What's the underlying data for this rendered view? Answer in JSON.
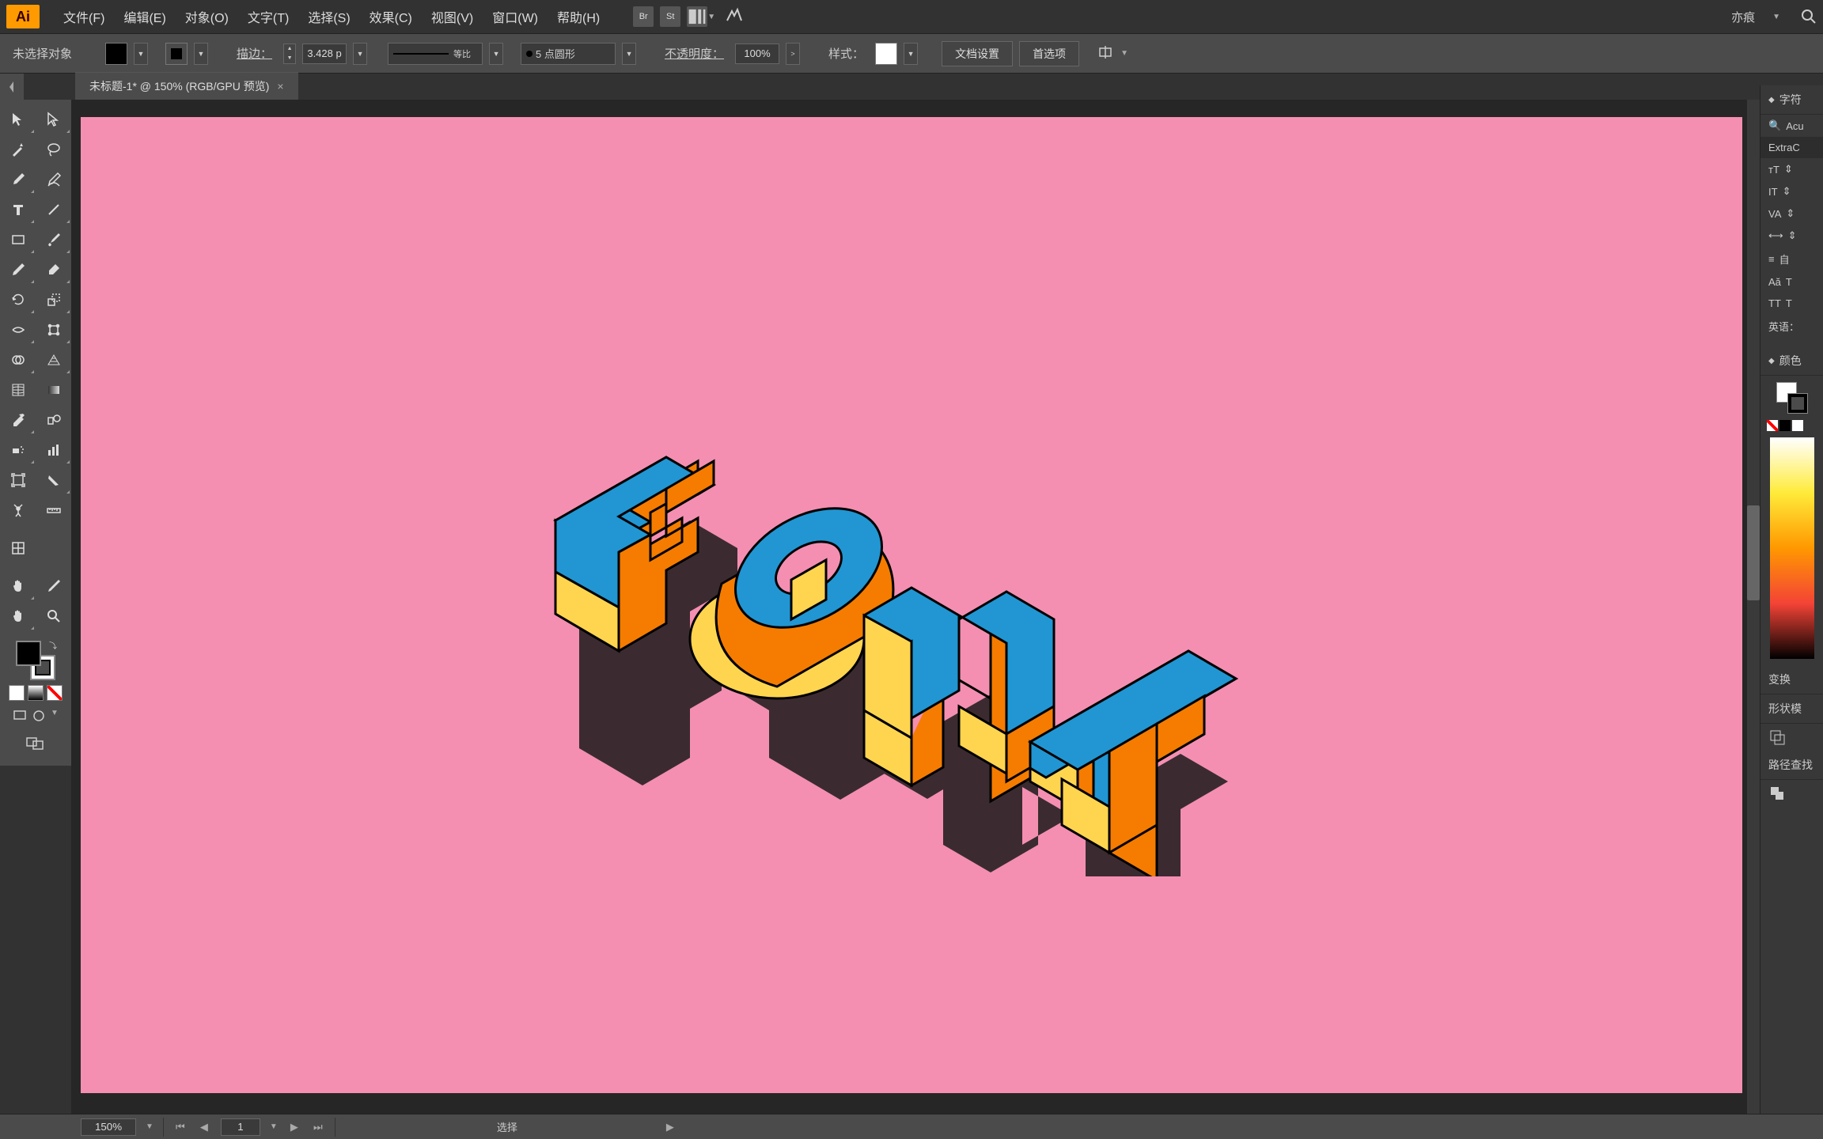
{
  "app": {
    "logo": "Ai"
  },
  "menu": {
    "file": "文件(F)",
    "edit": "编辑(E)",
    "object": "对象(O)",
    "text": "文字(T)",
    "select": "选择(S)",
    "effect": "效果(C)",
    "view": "视图(V)",
    "window": "窗口(W)",
    "help": "帮助(H)"
  },
  "menubar_right": {
    "icon1": "Br",
    "icon2": "St",
    "workspace": "亦痕"
  },
  "controlbar": {
    "no_selection": "未选择对象",
    "stroke_label": "描边：",
    "stroke_value": "3.428 p",
    "profile_label": "等比",
    "brush_value": "5 点圆形",
    "opacity_label": "不透明度：",
    "opacity_value": "100%",
    "style_label": "样式：",
    "doc_settings": "文档设置",
    "preferences": "首选项"
  },
  "tab": {
    "title": "未标题-1* @ 150% (RGB/GPU 预览)"
  },
  "canvas": {
    "bg_color": "#f48fb1",
    "text_content": "FONT",
    "text_top_color": "#2196d3",
    "text_side1_color": "#ffd54f",
    "text_side2_color": "#f57c00",
    "text_outline": "#000000"
  },
  "right_panels": {
    "character": "字符",
    "font_search": "Acu",
    "font_style": "ExtraC",
    "language": "英语：",
    "auto": "自",
    "color": "颜色",
    "transform": "变换",
    "shape_mode": "形状模",
    "pathfinder": "路径查找"
  },
  "statusbar": {
    "zoom": "150%",
    "page": "1",
    "tool": "选择"
  }
}
